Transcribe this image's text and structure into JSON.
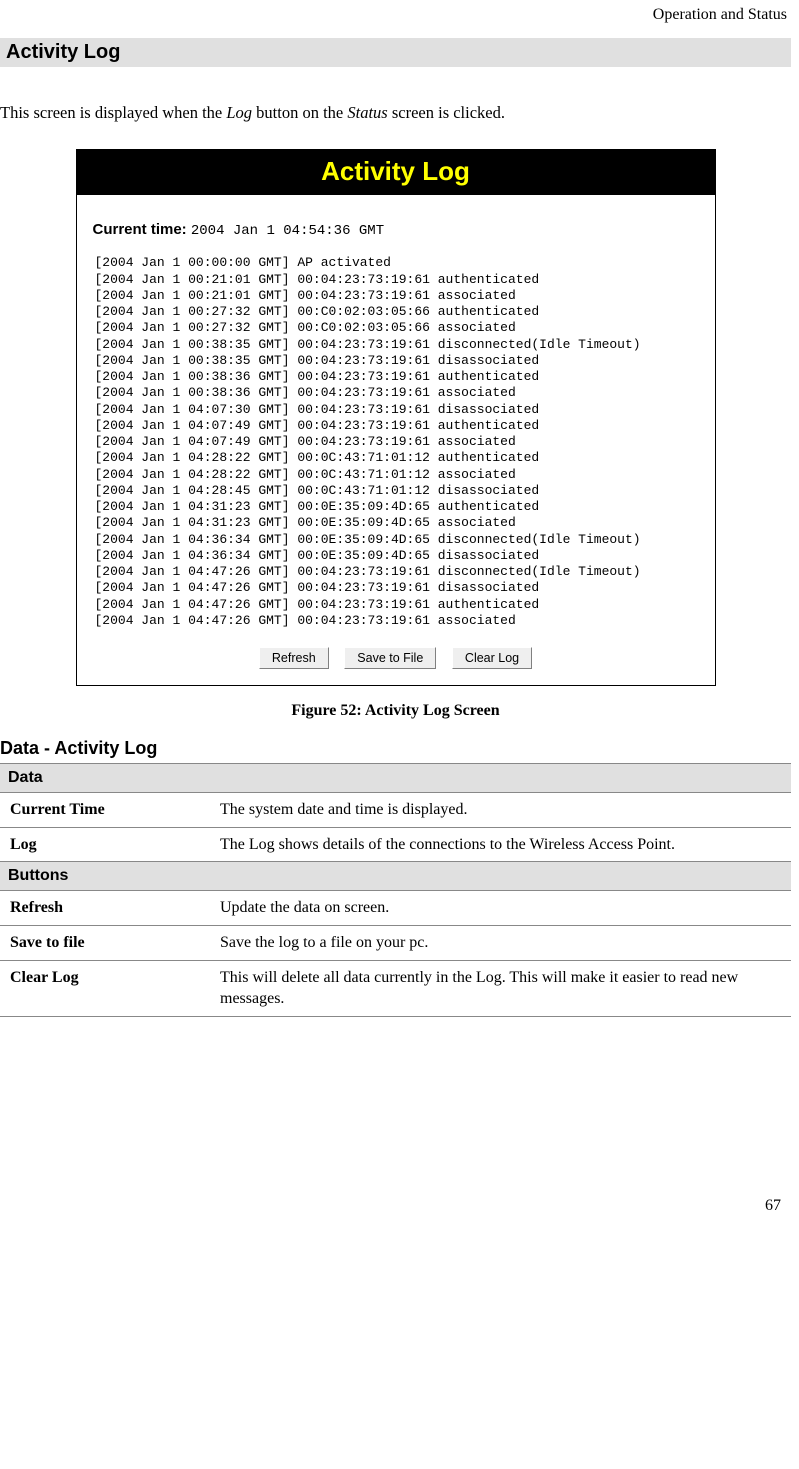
{
  "header": {
    "breadcrumb": "Operation and Status"
  },
  "section": {
    "title": "Activity Log",
    "intro_pre": "This screen is displayed when the ",
    "intro_em1": "Log",
    "intro_mid": " button on the ",
    "intro_em2": "Status",
    "intro_post": " screen is clicked."
  },
  "figure": {
    "titlebar": "Activity Log",
    "current_label": "Current time:",
    "current_value": "2004 Jan 1 04:54:36 GMT",
    "log_entries": [
      "[2004 Jan 1 00:00:00 GMT] AP activated",
      "[2004 Jan 1 00:21:01 GMT] 00:04:23:73:19:61 authenticated",
      "[2004 Jan 1 00:21:01 GMT] 00:04:23:73:19:61 associated",
      "[2004 Jan 1 00:27:32 GMT] 00:C0:02:03:05:66 authenticated",
      "[2004 Jan 1 00:27:32 GMT] 00:C0:02:03:05:66 associated",
      "[2004 Jan 1 00:38:35 GMT] 00:04:23:73:19:61 disconnected(Idle Timeout)",
      "[2004 Jan 1 00:38:35 GMT] 00:04:23:73:19:61 disassociated",
      "[2004 Jan 1 00:38:36 GMT] 00:04:23:73:19:61 authenticated",
      "[2004 Jan 1 00:38:36 GMT] 00:04:23:73:19:61 associated",
      "[2004 Jan 1 04:07:30 GMT] 00:04:23:73:19:61 disassociated",
      "[2004 Jan 1 04:07:49 GMT] 00:04:23:73:19:61 authenticated",
      "[2004 Jan 1 04:07:49 GMT] 00:04:23:73:19:61 associated",
      "[2004 Jan 1 04:28:22 GMT] 00:0C:43:71:01:12 authenticated",
      "[2004 Jan 1 04:28:22 GMT] 00:0C:43:71:01:12 associated",
      "[2004 Jan 1 04:28:45 GMT] 00:0C:43:71:01:12 disassociated",
      "[2004 Jan 1 04:31:23 GMT] 00:0E:35:09:4D:65 authenticated",
      "[2004 Jan 1 04:31:23 GMT] 00:0E:35:09:4D:65 associated",
      "[2004 Jan 1 04:36:34 GMT] 00:0E:35:09:4D:65 disconnected(Idle Timeout)",
      "[2004 Jan 1 04:36:34 GMT] 00:0E:35:09:4D:65 disassociated",
      "[2004 Jan 1 04:47:26 GMT] 00:04:23:73:19:61 disconnected(Idle Timeout)",
      "[2004 Jan 1 04:47:26 GMT] 00:04:23:73:19:61 disassociated",
      "[2004 Jan 1 04:47:26 GMT] 00:04:23:73:19:61 authenticated",
      "[2004 Jan 1 04:47:26 GMT] 00:04:23:73:19:61 associated"
    ],
    "buttons": {
      "refresh": "Refresh",
      "save": "Save to File",
      "clear": "Clear Log"
    },
    "caption": "Figure 52: Activity Log Screen"
  },
  "data_section": {
    "heading": "Data - Activity Log",
    "group1": "Data",
    "rows1": [
      {
        "term": "Current Time",
        "desc": "The system date and time is displayed."
      },
      {
        "term": "Log",
        "desc": "The Log shows details of the connections to the Wireless Access Point."
      }
    ],
    "group2": "Buttons",
    "rows2": [
      {
        "term": "Refresh",
        "desc": "Update the data on screen."
      },
      {
        "term": "Save to file",
        "desc": "Save the log to a file on your pc."
      },
      {
        "term": "Clear Log",
        "desc": "This will delete all data currently in the Log. This will make it easier to read new messages."
      }
    ]
  },
  "page_number": "67"
}
